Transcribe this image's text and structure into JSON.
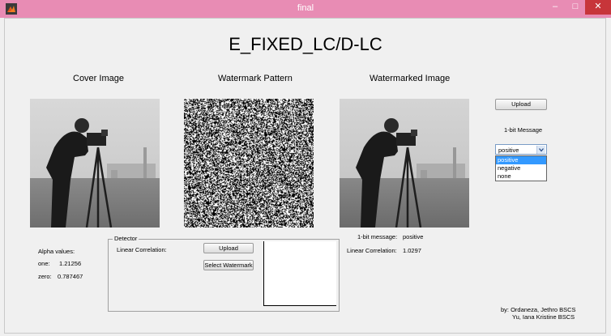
{
  "window": {
    "title": "final",
    "controls": {
      "minimize": "–",
      "maximize": "□",
      "close": "✕"
    }
  },
  "main_title": "E_FIXED_LC/D-LC",
  "panels": {
    "cover_label": "Cover Image",
    "watermark_label": "Watermark Pattern",
    "watermarked_label": "Watermarked Image"
  },
  "upload_button": "Upload",
  "message": {
    "label": "1-bit Message",
    "selected": "positive",
    "options": [
      "positive",
      "negative",
      "none"
    ]
  },
  "alpha": {
    "heading": "Alpha values:",
    "one_label": "one:",
    "one_value": "1.21256",
    "zero_label": "zero:",
    "zero_value": "0.787467"
  },
  "detector": {
    "title": "Detector",
    "linear_corr_label": "Linear Correlation:",
    "upload_button": "Upload",
    "select_watermark_button": "Select Watermark"
  },
  "result": {
    "message_label": "1-bit message:",
    "message_value": "positive",
    "corr_label": "Linear Correlation:",
    "corr_value": "1.0297"
  },
  "credits": {
    "line1": "by: Ordaneza, Jethro BSCS",
    "line2": "Yu, Iana Kristine BSCS"
  },
  "colors": {
    "titlebar": "#e88cb4",
    "close_button": "#c7353a",
    "selection": "#3399ff"
  },
  "icons": {
    "app": "matlab-logo-icon",
    "dropdown": "chevron-down-icon"
  }
}
